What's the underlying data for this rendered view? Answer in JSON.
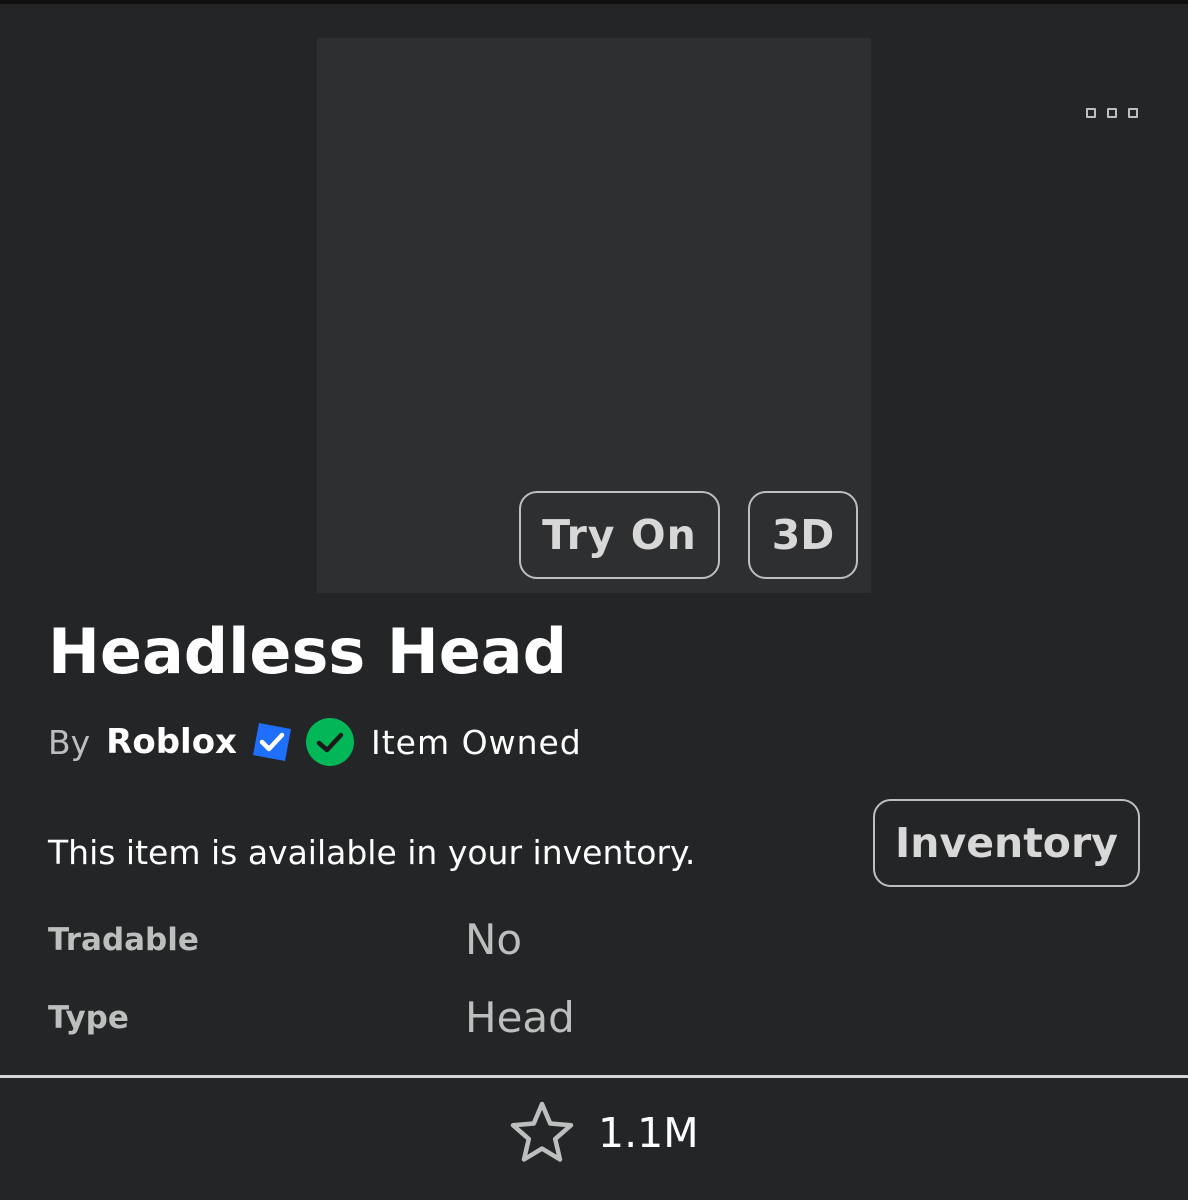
{
  "item": {
    "name": "Headless Head",
    "by_label": "By",
    "creator": "Roblox",
    "owned_label": "Item Owned",
    "availability_text": "This item is available in your inventory."
  },
  "preview": {
    "try_on_label": "Try On",
    "view_3d_label": "3D"
  },
  "actions": {
    "inventory_label": "Inventory",
    "more_menu_icon": "ellipsis-icon"
  },
  "details": [
    {
      "label": "Tradable",
      "value": "No"
    },
    {
      "label": "Type",
      "value": "Head"
    }
  ],
  "footer": {
    "favorite_icon": "star-outline-icon",
    "favorite_count": "1.1M"
  },
  "colors": {
    "background": "#232527",
    "preview_bg": "#2e2f31",
    "verified_blue": "#1f6fff",
    "owned_green": "#02b757",
    "muted_text": "#bdbebe"
  }
}
